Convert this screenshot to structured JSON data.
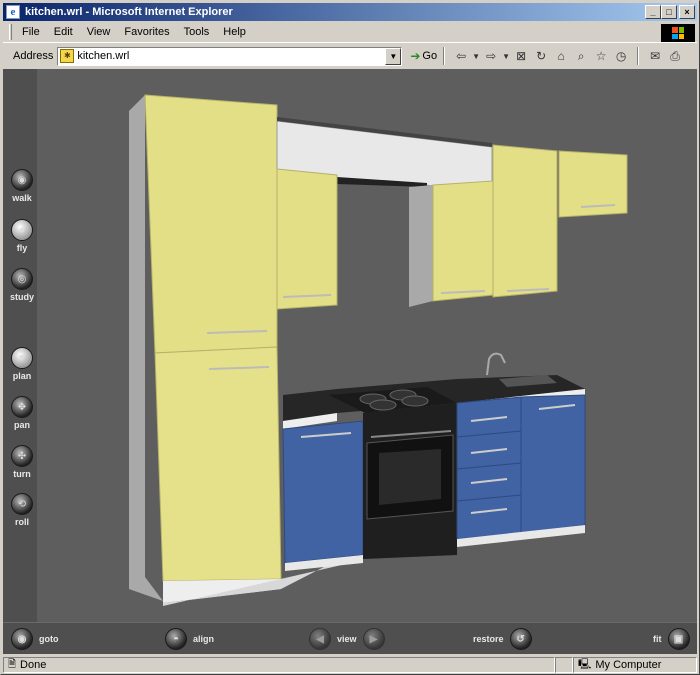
{
  "window": {
    "title": "kitchen.wrl - Microsoft Internet Explorer"
  },
  "menu": [
    "File",
    "Edit",
    "View",
    "Favorites",
    "Tools",
    "Help"
  ],
  "address": {
    "label": "Address",
    "value": "kitchen.wrl",
    "go_label": "Go"
  },
  "left_nav": [
    {
      "label": "walk",
      "icon": "walk-icon"
    },
    {
      "label": "fly",
      "icon": "fly-icon",
      "active": true
    },
    {
      "label": "study",
      "icon": "study-icon"
    },
    {
      "label": "plan",
      "icon": "plan-icon"
    },
    {
      "label": "pan",
      "icon": "pan-icon"
    },
    {
      "label": "turn",
      "icon": "turn-icon"
    },
    {
      "label": "roll",
      "icon": "roll-icon"
    }
  ],
  "bottom_nav": {
    "goto": "goto",
    "align": "align",
    "view": "view",
    "restore": "restore",
    "fit": "fit"
  },
  "status": {
    "left": "Done",
    "zone": "My Computer"
  },
  "colors": {
    "cabinet_yellow": "#e3df86",
    "cabinet_blue": "#4263a3",
    "counter_black": "#222222",
    "viewport_bg": "#5e5e5e"
  }
}
